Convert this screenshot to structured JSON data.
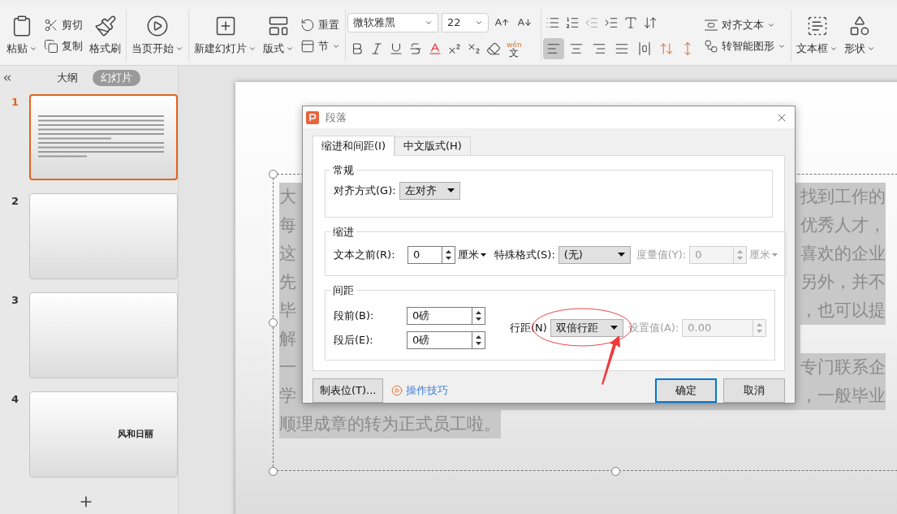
{
  "ribbon": {
    "paste": "粘贴",
    "cut": "剪切",
    "copy": "复制",
    "format_painter": "格式刷",
    "play": "当页开始",
    "new_slide": "新建幻灯片",
    "layout": "版式",
    "reset": "重置",
    "section": "节",
    "font_name": "微软雅黑",
    "font_size": "22",
    "phonetic": {
      "pinyin": "wén",
      "char": "文"
    },
    "align_buttons": [
      {
        "kind": "left",
        "selected": true
      },
      {
        "kind": "center",
        "selected": false
      },
      {
        "kind": "right",
        "selected": false
      },
      {
        "kind": "justify",
        "selected": false
      },
      {
        "kind": "distribute",
        "selected": false
      }
    ],
    "align_text": "对齐文本",
    "smart_art": "转智能图形",
    "textbox": "文本框",
    "shape": "形状"
  },
  "sidebar": {
    "tabs": [
      {
        "label": "大纲",
        "selected": false
      },
      {
        "label": "幻灯片",
        "selected": true
      }
    ],
    "slides": [
      {
        "number": "1",
        "selected": true,
        "kind": "text"
      },
      {
        "number": "2",
        "selected": false,
        "kind": "blank"
      },
      {
        "number": "3",
        "selected": false,
        "kind": "blank"
      },
      {
        "number": "4",
        "selected": false,
        "kind": "title",
        "title": "风和日丽"
      }
    ]
  },
  "slide": {
    "rows": [
      {
        "start": "大",
        "end": "找到工作的"
      },
      {
        "start": "每",
        "end": "优秀人才，"
      },
      {
        "start": "这",
        "end": "喜欢的企业"
      },
      {
        "start": "先",
        "end": "另外，并不"
      },
      {
        "start": "毕",
        "end": "，也可以提"
      },
      {
        "start": "解"
      },
      {
        "start": "一",
        "end": "专门联系企"
      },
      {
        "start": "学",
        "end": "，一般毕业"
      }
    ],
    "last_line": "顺理成章的转为正式员工啦。"
  },
  "dialog": {
    "title": "段落",
    "tabs": [
      {
        "label": "缩进和间距(I)",
        "selected": true
      },
      {
        "label": "中文版式(H)",
        "selected": false
      }
    ],
    "general": {
      "title": "常规",
      "alignment_label": "对齐方式(G):",
      "alignment": "左对齐"
    },
    "indent": {
      "title": "缩进",
      "before_label": "文本之前(R):",
      "before": "0",
      "before_unit": "厘米",
      "special_label": "特殊格式(S):",
      "special": "(无)",
      "measure_label": "度量值(Y):",
      "measure": "0",
      "measure_unit": "厘米",
      "measure_disabled": true
    },
    "spacing": {
      "title": "间距",
      "before_label": "段前(B):",
      "before": "0磅",
      "after_label": "段后(E):",
      "after": "0磅",
      "line_label": "行距(N)",
      "line": "双倍行距",
      "setting_label": "设置值(A):",
      "setting": "0.00",
      "setting_disabled": true
    },
    "tabs_button": "制表位(T)...",
    "tips": "操作技巧",
    "ok": "确定",
    "cancel": "取消"
  }
}
